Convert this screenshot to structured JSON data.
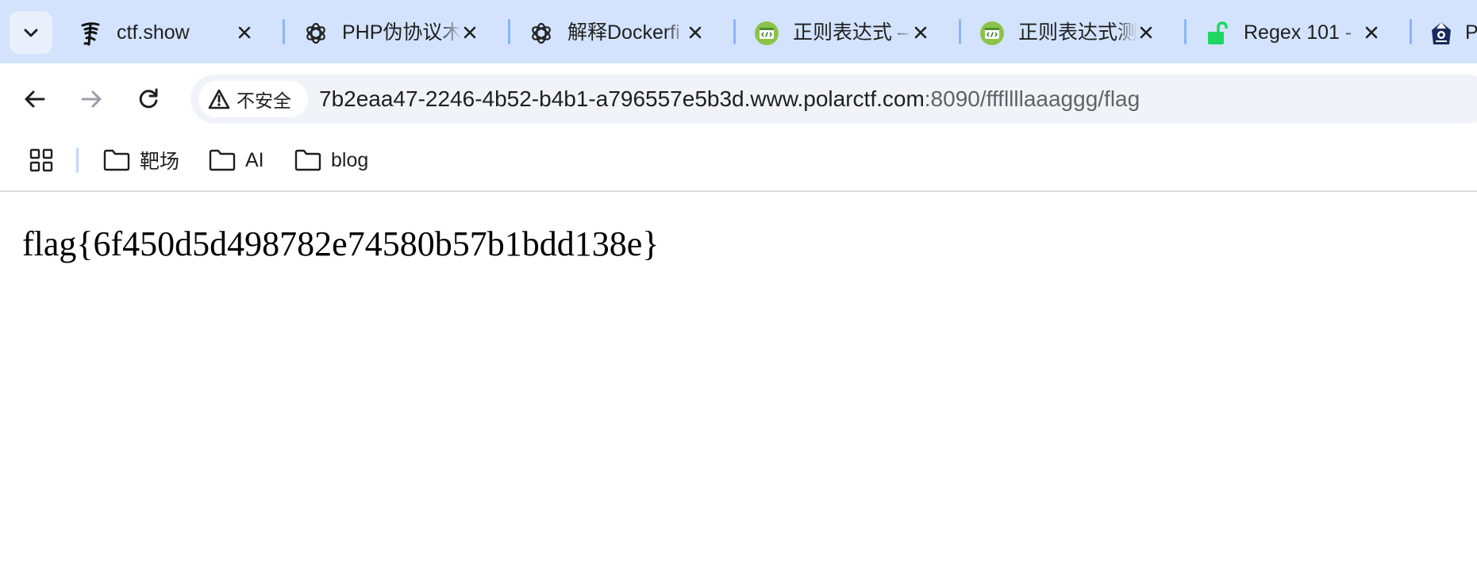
{
  "browser": {
    "tab_search_icon": "chevron-down-icon",
    "tabs": [
      {
        "title": "ctf.show",
        "favicon": "ctfshow-icon"
      },
      {
        "title": "PHP伪协议木",
        "favicon": "chatgpt-icon"
      },
      {
        "title": "解释Dockerfi",
        "favicon": "chatgpt-icon"
      },
      {
        "title": "正则表达式 –",
        "favicon": "regex-tool-icon"
      },
      {
        "title": "正则表达式测",
        "favicon": "regex-tool-icon"
      },
      {
        "title": "Regex 101 -",
        "favicon": "unlocked-padlock-icon"
      },
      {
        "title": "P",
        "favicon": "polarctf-icon"
      }
    ],
    "toolbar": {
      "back_icon": "back-arrow-icon",
      "forward_icon": "forward-arrow-icon",
      "reload_icon": "reload-icon",
      "security_label": "不安全",
      "url_host": "7b2eaa47-2246-4b52-b4b1-a796557e5b3d.www.polarctf.com",
      "url_rest": ":8090/fffllllaaaggg/flag"
    },
    "bookmarks": [
      {
        "label": "靶场"
      },
      {
        "label": "AI"
      },
      {
        "label": "blog"
      }
    ]
  },
  "page": {
    "text": "flag{6f450d5d498782e74580b57b1bdd138e}"
  },
  "colors": {
    "tabstrip": "#d3e3fd",
    "omnibox": "#f0f4f9",
    "tab_separator": "#8ab4f8",
    "regex_tool_green": "#8bc34a",
    "padlock_green": "#1ed760"
  }
}
